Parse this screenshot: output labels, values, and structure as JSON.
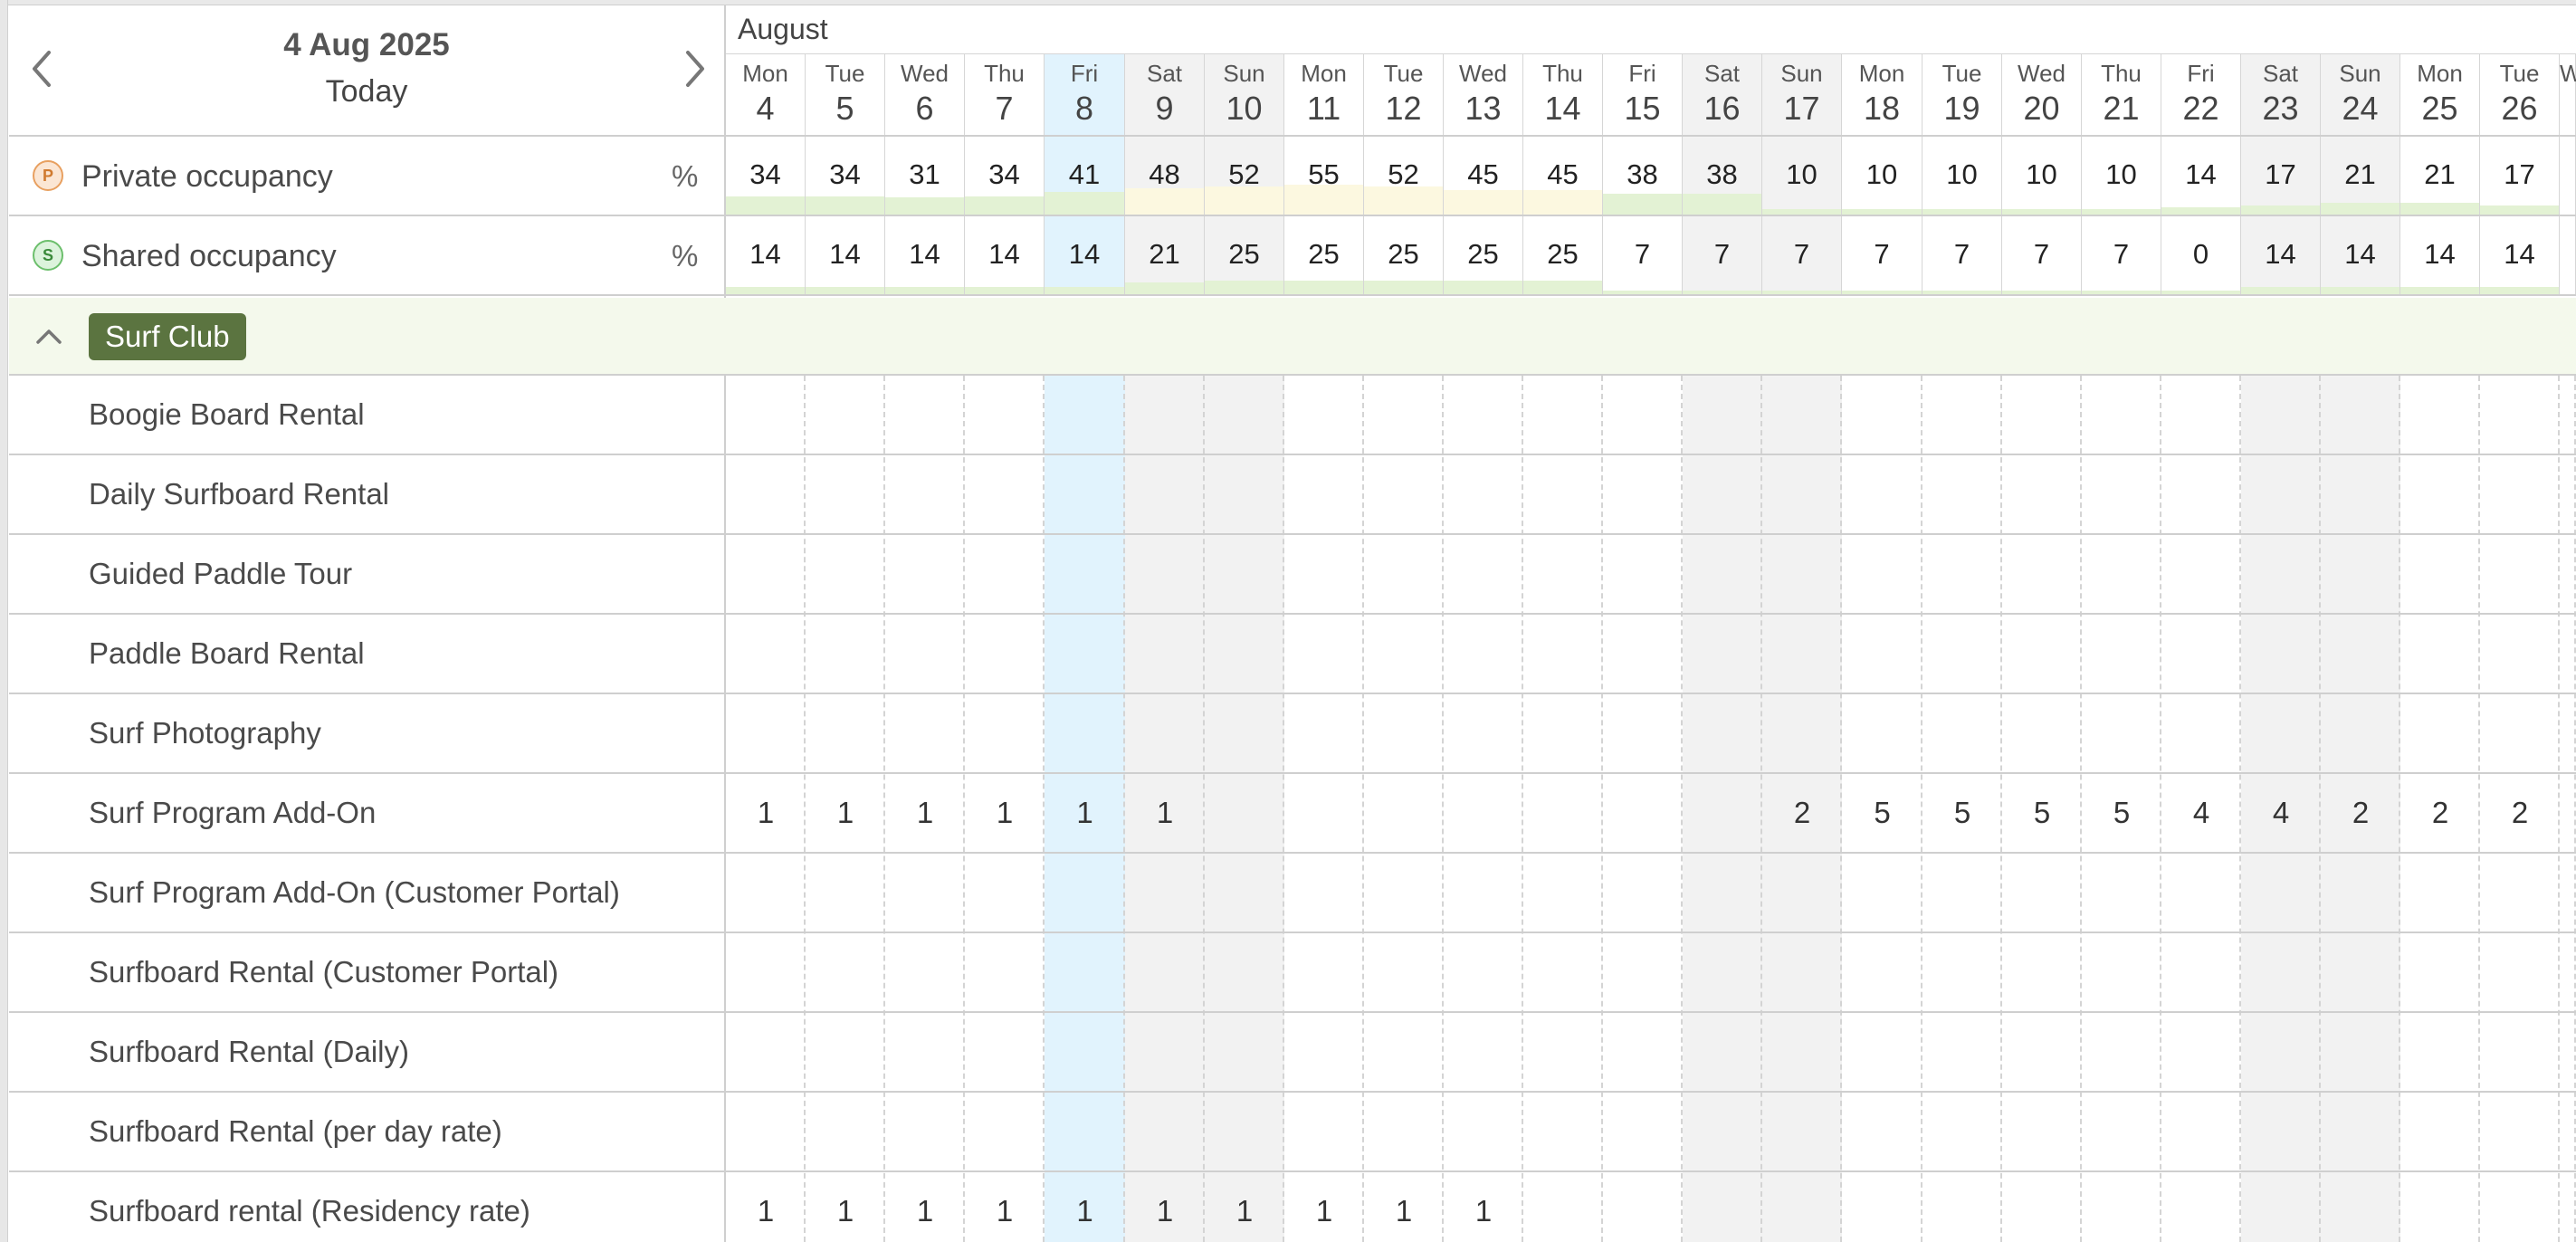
{
  "header": {
    "date": "4 Aug 2025",
    "today_label": "Today",
    "month": "August"
  },
  "days": [
    {
      "dow": "Mon",
      "num": "4",
      "kind": "normal"
    },
    {
      "dow": "Tue",
      "num": "5",
      "kind": "normal"
    },
    {
      "dow": "Wed",
      "num": "6",
      "kind": "normal"
    },
    {
      "dow": "Thu",
      "num": "7",
      "kind": "normal"
    },
    {
      "dow": "Fri",
      "num": "8",
      "kind": "today"
    },
    {
      "dow": "Sat",
      "num": "9",
      "kind": "weekend"
    },
    {
      "dow": "Sun",
      "num": "10",
      "kind": "weekend"
    },
    {
      "dow": "Mon",
      "num": "11",
      "kind": "normal"
    },
    {
      "dow": "Tue",
      "num": "12",
      "kind": "normal"
    },
    {
      "dow": "Wed",
      "num": "13",
      "kind": "normal"
    },
    {
      "dow": "Thu",
      "num": "14",
      "kind": "normal"
    },
    {
      "dow": "Fri",
      "num": "15",
      "kind": "normal"
    },
    {
      "dow": "Sat",
      "num": "16",
      "kind": "weekend"
    },
    {
      "dow": "Sun",
      "num": "17",
      "kind": "weekend"
    },
    {
      "dow": "Mon",
      "num": "18",
      "kind": "normal"
    },
    {
      "dow": "Tue",
      "num": "19",
      "kind": "normal"
    },
    {
      "dow": "Wed",
      "num": "20",
      "kind": "normal"
    },
    {
      "dow": "Thu",
      "num": "21",
      "kind": "normal"
    },
    {
      "dow": "Fri",
      "num": "22",
      "kind": "normal"
    },
    {
      "dow": "Sat",
      "num": "23",
      "kind": "weekend"
    },
    {
      "dow": "Sun",
      "num": "24",
      "kind": "weekend"
    },
    {
      "dow": "Mon",
      "num": "25",
      "kind": "normal"
    },
    {
      "dow": "Tue",
      "num": "26",
      "kind": "normal"
    },
    {
      "dow": "W",
      "num": "",
      "kind": "normal"
    }
  ],
  "occupancy": [
    {
      "icon": "P",
      "label": "Private occupancy",
      "unit": "%",
      "values": [
        "34",
        "34",
        "31",
        "34",
        "41",
        "48",
        "52",
        "55",
        "52",
        "45",
        "45",
        "38",
        "38",
        "10",
        "10",
        "10",
        "10",
        "10",
        "14",
        "17",
        "21",
        "21",
        "17",
        ""
      ]
    },
    {
      "icon": "S",
      "label": "Shared occupancy",
      "unit": "%",
      "values": [
        "14",
        "14",
        "14",
        "14",
        "14",
        "21",
        "25",
        "25",
        "25",
        "25",
        "25",
        "7",
        "7",
        "7",
        "7",
        "7",
        "7",
        "7",
        "0",
        "14",
        "14",
        "14",
        "14",
        ""
      ]
    }
  ],
  "group": {
    "name": "Surf Club"
  },
  "rows": [
    {
      "label": "Boogie Board Rental",
      "values": [
        "",
        "",
        "",
        "",
        "",
        "",
        "",
        "",
        "",
        "",
        "",
        "",
        "",
        "",
        "",
        "",
        "",
        "",
        "",
        "",
        "",
        "",
        "",
        ""
      ]
    },
    {
      "label": "Daily Surfboard Rental",
      "values": [
        "",
        "",
        "",
        "",
        "",
        "",
        "",
        "",
        "",
        "",
        "",
        "",
        "",
        "",
        "",
        "",
        "",
        "",
        "",
        "",
        "",
        "",
        "",
        ""
      ]
    },
    {
      "label": "Guided Paddle Tour",
      "values": [
        "",
        "",
        "",
        "",
        "",
        "",
        "",
        "",
        "",
        "",
        "",
        "",
        "",
        "",
        "",
        "",
        "",
        "",
        "",
        "",
        "",
        "",
        "",
        ""
      ]
    },
    {
      "label": "Paddle Board Rental",
      "values": [
        "",
        "",
        "",
        "",
        "",
        "",
        "",
        "",
        "",
        "",
        "",
        "",
        "",
        "",
        "",
        "",
        "",
        "",
        "",
        "",
        "",
        "",
        "",
        ""
      ]
    },
    {
      "label": "Surf Photography",
      "values": [
        "",
        "",
        "",
        "",
        "",
        "",
        "",
        "",
        "",
        "",
        "",
        "",
        "",
        "",
        "",
        "",
        "",
        "",
        "",
        "",
        "",
        "",
        "",
        ""
      ]
    },
    {
      "label": "Surf Program Add-On",
      "values": [
        "1",
        "1",
        "1",
        "1",
        "1",
        "1",
        "",
        "",
        "",
        "",
        "",
        "",
        "",
        "2",
        "5",
        "5",
        "5",
        "5",
        "4",
        "4",
        "2",
        "2",
        "2",
        ""
      ]
    },
    {
      "label": "Surf Program Add-On (Customer Portal)",
      "values": [
        "",
        "",
        "",
        "",
        "",
        "",
        "",
        "",
        "",
        "",
        "",
        "",
        "",
        "",
        "",
        "",
        "",
        "",
        "",
        "",
        "",
        "",
        "",
        ""
      ]
    },
    {
      "label": "Surfboard Rental (Customer Portal)",
      "values": [
        "",
        "",
        "",
        "",
        "",
        "",
        "",
        "",
        "",
        "",
        "",
        "",
        "",
        "",
        "",
        "",
        "",
        "",
        "",
        "",
        "",
        "",
        "",
        ""
      ]
    },
    {
      "label": "Surfboard Rental (Daily)",
      "values": [
        "",
        "",
        "",
        "",
        "",
        "",
        "",
        "",
        "",
        "",
        "",
        "",
        "",
        "",
        "",
        "",
        "",
        "",
        "",
        "",
        "",
        "",
        "",
        ""
      ]
    },
    {
      "label": "Surfboard Rental (per day rate)",
      "values": [
        "",
        "",
        "",
        "",
        "",
        "",
        "",
        "",
        "",
        "",
        "",
        "",
        "",
        "",
        "",
        "",
        "",
        "",
        "",
        "",
        "",
        "",
        "",
        ""
      ]
    },
    {
      "label": "Surfboard rental (Residency rate)",
      "values": [
        "1",
        "1",
        "1",
        "1",
        "1",
        "1",
        "1",
        "1",
        "1",
        "1",
        "",
        "",
        "",
        "",
        "",
        "",
        "",
        "",
        "",
        "",
        "",
        "",
        "",
        ""
      ]
    }
  ],
  "colors": {
    "today_bg": "#e1f3fd",
    "weekend_bg": "#f2f2f2",
    "bar_green": "#e3f2d4",
    "bar_yellow": "#fcf8e0",
    "group_chip": "#5b7440"
  }
}
